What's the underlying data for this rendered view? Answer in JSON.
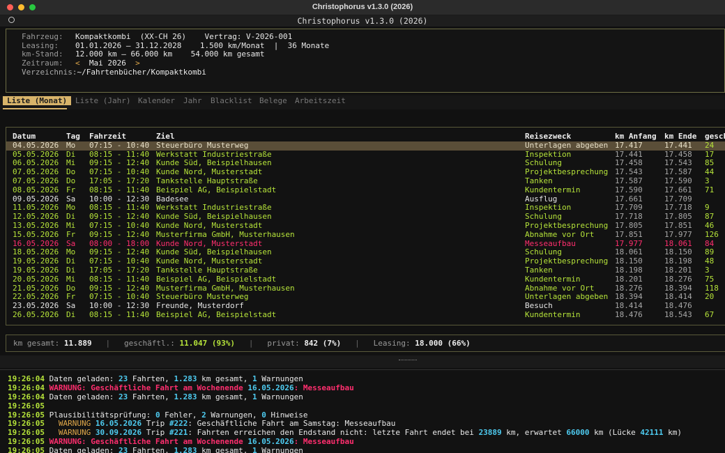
{
  "window": {
    "title": "Christophorus v1.3.0 (2026)"
  },
  "app": {
    "title": "Christophorus v1.3.0 (2026)"
  },
  "info": {
    "fahrzeug_label": "Fahrzeug:",
    "fahrzeug": "Kompaktkombi  (XX-CH 26)",
    "vertrag": "Vertrag: V-2026-001",
    "leasing_label": "Leasing:",
    "leasing": "01.01.2026 – 31.12.2028",
    "rate": "1.500 km/Monat",
    "bar": "|",
    "dauer": "36 Monate",
    "km_label": "km-Stand:",
    "km_range": "12.000 km – 66.000 km",
    "km_total": "54.000 km gesamt",
    "zeitraum_label": "Zeitraum:",
    "prev": "<",
    "zeitraum": "Mai 2026",
    "next": ">",
    "verz_label": "Verzeichnis:",
    "verz": "~/Fahrtenbücher/Kompaktkombi"
  },
  "tabs": [
    "Liste (Monat)",
    "Liste (Jahr)",
    "Kalender",
    "Jahr",
    "Blacklist",
    "Belege",
    "Arbeitszeit"
  ],
  "table": {
    "headers": [
      "Datum",
      "Tag",
      "Fahrzeit",
      "Ziel",
      "Reisezweck",
      "km Anfang",
      "km Ende",
      "gesch"
    ],
    "rows": [
      {
        "d": "04.05.2026",
        "t": "Mo",
        "f": "07:15 - 10:40",
        "z": "Steuerbüro Musterweg",
        "r": "Unterlagen abgeben",
        "a": "17.417",
        "e": "17.441",
        "g": "24",
        "k": "sel"
      },
      {
        "d": "05.05.2026",
        "t": "Di",
        "f": "08:15 - 11:40",
        "z": "Werkstatt Industriestraße",
        "r": "Inspektion",
        "a": "17.441",
        "e": "17.458",
        "g": "17",
        "k": "biz"
      },
      {
        "d": "06.05.2026",
        "t": "Mi",
        "f": "09:15 - 12:40",
        "z": "Kunde Süd, Beispielhausen",
        "r": "Schulung",
        "a": "17.458",
        "e": "17.543",
        "g": "85",
        "k": "biz"
      },
      {
        "d": "07.05.2026",
        "t": "Do",
        "f": "07:15 - 10:40",
        "z": "Kunde Nord, Musterstadt",
        "r": "Projektbesprechung",
        "a": "17.543",
        "e": "17.587",
        "g": "44",
        "k": "biz"
      },
      {
        "d": "07.05.2026",
        "t": "Do",
        "f": "17:05 - 17:20",
        "z": "Tankstelle Hauptstraße",
        "r": "Tanken",
        "a": "17.587",
        "e": "17.590",
        "g": "3",
        "k": "biz"
      },
      {
        "d": "08.05.2026",
        "t": "Fr",
        "f": "08:15 - 11:40",
        "z": "Beispiel AG, Beispielstadt",
        "r": "Kundentermin",
        "a": "17.590",
        "e": "17.661",
        "g": "71",
        "k": "biz"
      },
      {
        "d": "09.05.2026",
        "t": "Sa",
        "f": "10:00 - 12:30",
        "z": "Badesee",
        "r": "Ausflug",
        "a": "17.661",
        "e": "17.709",
        "g": "",
        "k": "priv"
      },
      {
        "d": "11.05.2026",
        "t": "Mo",
        "f": "08:15 - 11:40",
        "z": "Werkstatt Industriestraße",
        "r": "Inspektion",
        "a": "17.709",
        "e": "17.718",
        "g": "9",
        "k": "biz"
      },
      {
        "d": "12.05.2026",
        "t": "Di",
        "f": "09:15 - 12:40",
        "z": "Kunde Süd, Beispielhausen",
        "r": "Schulung",
        "a": "17.718",
        "e": "17.805",
        "g": "87",
        "k": "biz"
      },
      {
        "d": "13.05.2026",
        "t": "Mi",
        "f": "07:15 - 10:40",
        "z": "Kunde Nord, Musterstadt",
        "r": "Projektbesprechung",
        "a": "17.805",
        "e": "17.851",
        "g": "46",
        "k": "biz"
      },
      {
        "d": "15.05.2026",
        "t": "Fr",
        "f": "09:15 - 12:40",
        "z": "Musterfirma GmbH, Musterhausen",
        "r": "Abnahme vor Ort",
        "a": "17.851",
        "e": "17.977",
        "g": "126",
        "k": "biz"
      },
      {
        "d": "16.05.2026",
        "t": "Sa",
        "f": "08:00 - 18:00",
        "z": "Kunde Nord, Musterstadt",
        "r": "Messeaufbau",
        "a": "17.977",
        "e": "18.061",
        "g": "84",
        "k": "err"
      },
      {
        "d": "18.05.2026",
        "t": "Mo",
        "f": "09:15 - 12:40",
        "z": "Kunde Süd, Beispielhausen",
        "r": "Schulung",
        "a": "18.061",
        "e": "18.150",
        "g": "89",
        "k": "biz"
      },
      {
        "d": "19.05.2026",
        "t": "Di",
        "f": "07:15 - 10:40",
        "z": "Kunde Nord, Musterstadt",
        "r": "Projektbesprechung",
        "a": "18.150",
        "e": "18.198",
        "g": "48",
        "k": "biz"
      },
      {
        "d": "19.05.2026",
        "t": "Di",
        "f": "17:05 - 17:20",
        "z": "Tankstelle Hauptstraße",
        "r": "Tanken",
        "a": "18.198",
        "e": "18.201",
        "g": "3",
        "k": "biz"
      },
      {
        "d": "20.05.2026",
        "t": "Mi",
        "f": "08:15 - 11:40",
        "z": "Beispiel AG, Beispielstadt",
        "r": "Kundentermin",
        "a": "18.201",
        "e": "18.276",
        "g": "75",
        "k": "biz"
      },
      {
        "d": "21.05.2026",
        "t": "Do",
        "f": "09:15 - 12:40",
        "z": "Musterfirma GmbH, Musterhausen",
        "r": "Abnahme vor Ort",
        "a": "18.276",
        "e": "18.394",
        "g": "118",
        "k": "biz"
      },
      {
        "d": "22.05.2026",
        "t": "Fr",
        "f": "07:15 - 10:40",
        "z": "Steuerbüro Musterweg",
        "r": "Unterlagen abgeben",
        "a": "18.394",
        "e": "18.414",
        "g": "20",
        "k": "biz"
      },
      {
        "d": "23.05.2026",
        "t": "Sa",
        "f": "10:00 - 12:30",
        "z": "Freunde, Musterdorf",
        "r": "Besuch",
        "a": "18.414",
        "e": "18.476",
        "g": "",
        "k": "priv"
      },
      {
        "d": "26.05.2026",
        "t": "Di",
        "f": "08:15 - 11:40",
        "z": "Beispiel AG, Beispielstadt",
        "r": "Kundentermin",
        "a": "18.476",
        "e": "18.543",
        "g": "67",
        "k": "biz"
      }
    ]
  },
  "summary": {
    "gesamt_label": "km gesamt:",
    "gesamt": "11.889",
    "gesch_label": "geschäftl.:",
    "gesch": "11.047 (93%)",
    "privat_label": "privat:",
    "privat": "842 (7%)",
    "leasing_label": "Leasing:",
    "leasing": "18.000 (66%)",
    "sep": "|"
  },
  "log": [
    [
      [
        "ts",
        "19:26:04"
      ],
      [
        "w",
        " Daten geladen: "
      ],
      [
        "cy",
        "23"
      ],
      [
        "w",
        " Fahrten, "
      ],
      [
        "cy",
        "1.283"
      ],
      [
        "w",
        " km gesamt, "
      ],
      [
        "cy",
        "1"
      ],
      [
        "w",
        " Warnungen"
      ]
    ],
    [
      [
        "ts",
        "19:26:04"
      ],
      [
        "w",
        " "
      ],
      [
        "warn",
        "WARNUNG: Geschäftliche Fahrt am Wochenende "
      ],
      [
        "cy",
        "16.05.2026"
      ],
      [
        "warn",
        ": Messeaufbau"
      ]
    ],
    [
      [
        "ts",
        "19:26:04"
      ],
      [
        "w",
        " Daten geladen: "
      ],
      [
        "cy",
        "23"
      ],
      [
        "w",
        " Fahrten, "
      ],
      [
        "cy",
        "1.283"
      ],
      [
        "w",
        " km gesamt, "
      ],
      [
        "cy",
        "1"
      ],
      [
        "w",
        " Warnungen"
      ]
    ],
    [
      [
        "ts",
        "19:26:05"
      ]
    ],
    [
      [
        "ts",
        "19:26:05"
      ],
      [
        "w",
        " Plausibilitätsprüfung: "
      ],
      [
        "cy",
        "0"
      ],
      [
        "w",
        " Fehler, "
      ],
      [
        "cy",
        "2"
      ],
      [
        "w",
        " Warnungen, "
      ],
      [
        "cy",
        "0"
      ],
      [
        "w",
        " Hinweise"
      ]
    ],
    [
      [
        "ts",
        "19:26:05"
      ],
      [
        "w",
        "   "
      ],
      [
        "warn2",
        "WARNUNG"
      ],
      [
        "w",
        " "
      ],
      [
        "cy",
        "16.05.2026"
      ],
      [
        "w",
        " Trip "
      ],
      [
        "cy",
        "#222"
      ],
      [
        "w",
        ": Geschäftliche Fahrt am Samstag: Messeaufbau"
      ]
    ],
    [
      [
        "ts",
        "19:26:05"
      ],
      [
        "w",
        "   "
      ],
      [
        "warn2",
        "WARNUNG"
      ],
      [
        "w",
        " "
      ],
      [
        "cy",
        "30.09.2026"
      ],
      [
        "w",
        " Trip "
      ],
      [
        "cy",
        "#221"
      ],
      [
        "w",
        ": Fahrten erreichen den Endstand nicht: letzte Fahrt endet bei "
      ],
      [
        "cy",
        "23889"
      ],
      [
        "w",
        " km, erwartet "
      ],
      [
        "cy",
        "66000"
      ],
      [
        "w",
        " km (Lücke "
      ],
      [
        "cy",
        "42111"
      ],
      [
        "w",
        " km)"
      ]
    ],
    [
      [
        "ts",
        "19:26:05"
      ],
      [
        "w",
        " "
      ],
      [
        "warn",
        "WARNUNG: Geschäftliche Fahrt am Wochenende "
      ],
      [
        "cy",
        "16.05.2026"
      ],
      [
        "warn",
        ": Messeaufbau"
      ]
    ],
    [
      [
        "ts",
        "19:26:05"
      ],
      [
        "w",
        " Daten geladen: "
      ],
      [
        "cy",
        "23"
      ],
      [
        "w",
        " Fahrten, "
      ],
      [
        "cy",
        "1.283"
      ],
      [
        "w",
        " km gesamt, "
      ],
      [
        "cy",
        "1"
      ],
      [
        "w",
        " Warnungen"
      ]
    ]
  ]
}
